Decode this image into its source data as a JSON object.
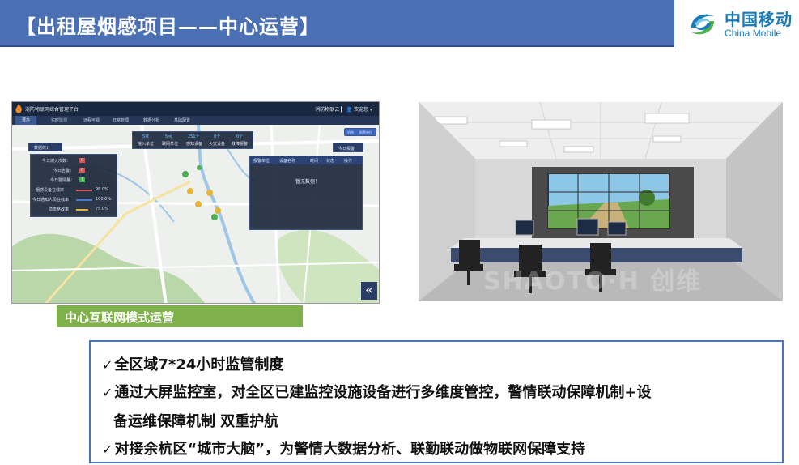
{
  "header": {
    "title": "【出租屋烟感项目——中心运营】",
    "logo_cn": "中国移动",
    "logo_en": "China Mobile"
  },
  "dashboard": {
    "brand": "消防物联网综合管理平台",
    "user": "消防物联云 ▎ 👤 欢迎您 ▾",
    "nav": [
      "首页",
      "实时监测",
      "远程可视",
      "日常管理",
      "数据分析",
      "基础配置"
    ],
    "stats_button": "数据统计",
    "top_badges": [
      {
        "count": "5家",
        "label": "接入单位"
      },
      {
        "count": "5间",
        "label": "联网单位"
      },
      {
        "count": "251个",
        "label": "感知设备"
      },
      {
        "count": "0个",
        "label": "火灾设备"
      },
      {
        "count": "0个",
        "label": "故障报警"
      }
    ],
    "today_alarm_button": "今日报警",
    "toggle_labels": [
      "机构",
      "报警单位"
    ],
    "stats_rows": [
      {
        "label": "今日减火次数：",
        "value": "0",
        "bar_value": null
      },
      {
        "label": "今日告警：",
        "value": "0",
        "bar_value": null
      },
      {
        "label": "今日警情量：",
        "value": "1",
        "bar_value": null
      },
      {
        "label": "烟感设备在线率",
        "value": "98.0%",
        "bar_value": 0.98
      },
      {
        "label": "今日通知人员在线率",
        "value": "100.0%",
        "bar_value": 1.0
      },
      {
        "label": "隐患整改率",
        "value": "75.0%",
        "bar_value": 0.75
      }
    ],
    "alarm_table_headers": [
      "报警单位",
      "设备名称",
      "时间",
      "状态",
      "操作"
    ],
    "alarm_table_empty": "暂无数据！",
    "collapse_icon": "«"
  },
  "caption": "中心互联网模式运营",
  "photo": {
    "watermark": "SHAOTO∙H 创维"
  },
  "bullets": [
    {
      "check": "✓",
      "text": "全区域7*24小时监管制度"
    },
    {
      "check": "✓",
      "text": "通过大屏监控室，对全区已建监控设施设备进行多维度管控，警情联动保障机制+设"
    },
    {
      "check": "",
      "text": "备运维保障机制  双重护航"
    },
    {
      "check": "✓",
      "text": "对接余杭区“城市大脑”，为警情大数据分析、联勤联动做物联网保障支持"
    }
  ],
  "colors": {
    "title_bar": "#4a6fb3",
    "caption_bg": "#7fb14a",
    "bullet_border": "#4a73b8",
    "logo_blue": "#1a7ab8"
  }
}
